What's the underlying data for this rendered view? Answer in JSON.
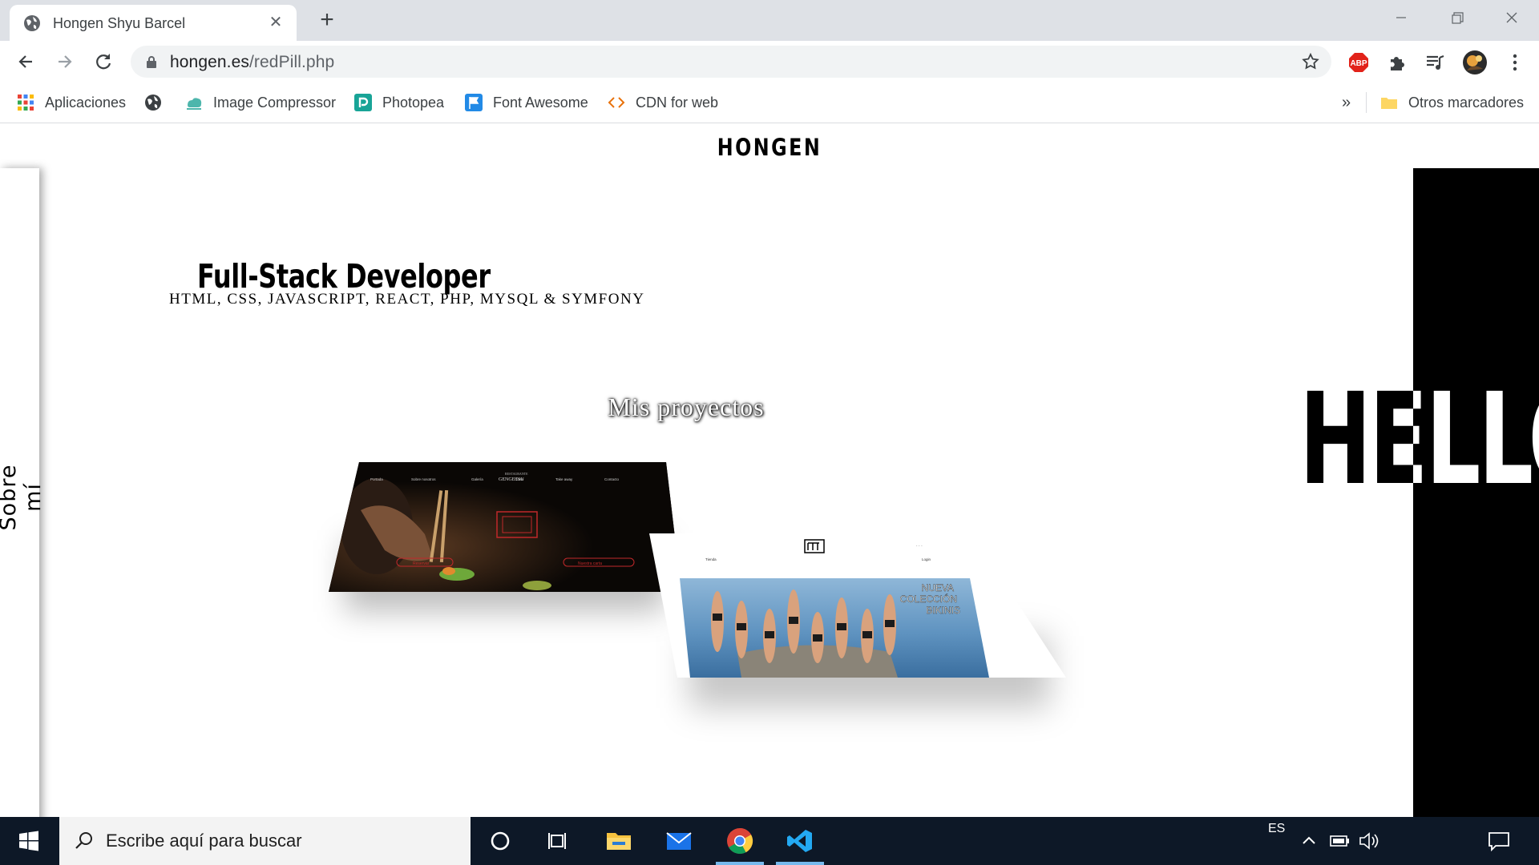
{
  "browser": {
    "tab_title": "Hongen Shyu Barcel",
    "url_host": "hongen.es",
    "url_path": "/redPill.php",
    "bookmarks": [
      {
        "label": "Aplicaciones",
        "icon": "apps-grid-icon"
      },
      {
        "label": "",
        "icon": "globe-icon"
      },
      {
        "label": "Image Compressor",
        "icon": "image-compressor-icon"
      },
      {
        "label": "Photopea",
        "icon": "photopea-icon"
      },
      {
        "label": "Font Awesome",
        "icon": "font-awesome-flag-icon"
      },
      {
        "label": "CDN for web",
        "icon": "code-brackets-icon"
      }
    ],
    "more_bookmarks": "»",
    "other_bookmarks": "Otros marcadores"
  },
  "page": {
    "logo": "HONGEN",
    "sidebar_label": "Sobre mí",
    "headline": "Full-Stack Developer",
    "stack": "HTML, CSS, JAVASCRIPT, REACT, PHP, MYSQL & SYMFONY",
    "projects_title": "Mis proyectos",
    "hello": "HELLO",
    "project1": {
      "brand_small": "RESTAURANTE",
      "brand": "GENGETSU",
      "nav": [
        "Portada",
        "Sobre nosotros",
        "Galería",
        "Carta",
        "Take away",
        "Contacto"
      ],
      "btn_left": "Reservar",
      "btn_right": "Nuestra carta"
    },
    "project2": {
      "nav_left": "Tienda",
      "nav_right": "Login",
      "headline_lines": [
        "NUEVA",
        "COLECCIÓN",
        "BIKINIS"
      ]
    }
  },
  "taskbar": {
    "search_placeholder": "Escribe aquí para buscar",
    "language": "ES"
  },
  "colors": {
    "tabbar": "#dee1e6",
    "taskbar": "#0d1827",
    "abp_red": "#e2231a",
    "accent_blue": "#1a73e8"
  }
}
